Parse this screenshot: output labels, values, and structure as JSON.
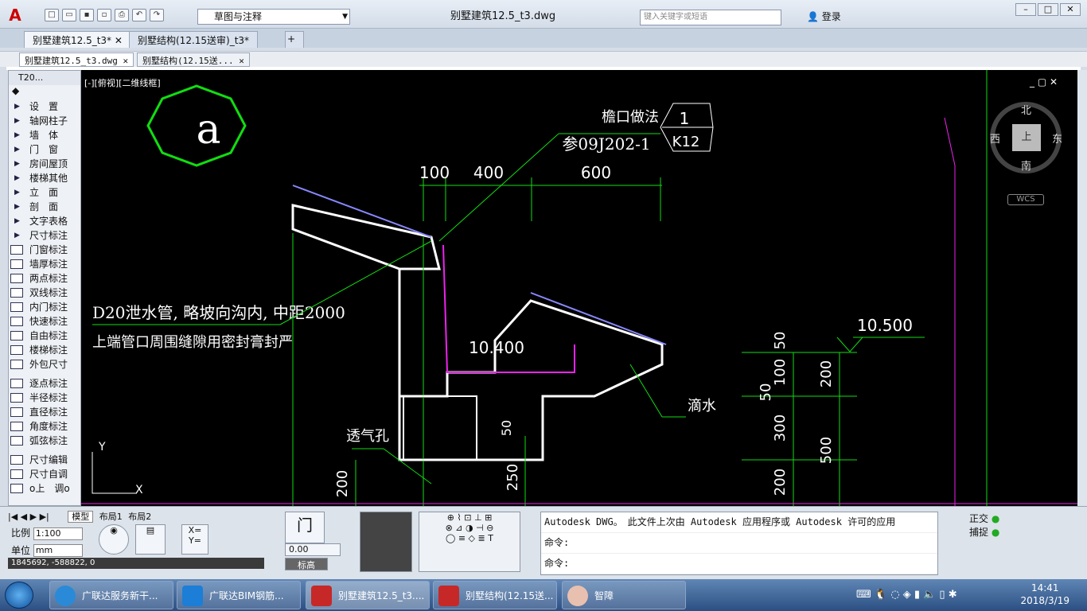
{
  "app": {
    "logo": "A",
    "workspace": "草图与注释",
    "title": "别墅建筑12.5_t3.dwg",
    "search_placeholder": "键入关键字或短语",
    "login": "登录"
  },
  "file_tabs": [
    "别墅建筑12.5_t3*",
    "别墅结构(12.15送审)_t3*"
  ],
  "doc_tabs": [
    "别墅建筑12.5_t3.dwg",
    "别墅结构(12.15送..."
  ],
  "left_panel": {
    "title": "T20...",
    "items": [
      "设　置",
      "轴网柱子",
      "墙　体",
      "门　窗",
      "房间屋顶",
      "楼梯其他",
      "立　面",
      "剖　面",
      "文字表格",
      "尺寸标注"
    ],
    "dim_items": [
      "门窗标注",
      "墙厚标注",
      "两点标注",
      "双线标注",
      "内门标注",
      "快速标注",
      "自由标注",
      "楼梯标注",
      "外包尺寸"
    ],
    "dim_items2": [
      "逐点标注",
      "半径标注",
      "直径标注",
      "角度标注",
      "弧弦标注"
    ],
    "dim_items3": [
      "尺寸编辑",
      "尺寸自调",
      "o上　调o"
    ]
  },
  "canvas": {
    "view_label": "[-][俯视][二维线框]",
    "symbol_letter": "a",
    "detail_title": "檐口做法",
    "detail_ref": "参09J202-1",
    "detail_num": "1",
    "detail_sheet": "K12",
    "dims_top": [
      "100",
      "400",
      "600"
    ],
    "note1": "D20泄水管, 略坡向沟内, 中距2000",
    "note2": "上端管口周围缝隙用密封膏封严",
    "elev1": "10.400",
    "elev2": "10.500",
    "drip": "滴水",
    "vent": "透气孔",
    "dims_right": [
      "50",
      "100",
      "50",
      "300",
      "200",
      "200",
      "500"
    ],
    "dims_left": [
      "200",
      "50",
      "250"
    ],
    "ucs_y": "Y",
    "ucs_x": "X"
  },
  "viewcube": {
    "north": "北",
    "south": "南",
    "west": "西",
    "east": "东",
    "top": "上",
    "wcs": "WCS"
  },
  "bottom": {
    "layout_tabs": [
      "模型",
      "布局1",
      "布局2"
    ],
    "scale_label": "比例",
    "scale_value": "1:100",
    "unit_label": "单位",
    "unit_value": "mm",
    "coords": "1845692, -588822, 0",
    "elev_value": "0.00",
    "elev_label": "标高",
    "ortho": "正交",
    "snap": "捕捉",
    "cmd_lines": [
      "Autodesk DWG。　此文件上次由 Autodesk 应用程序或 Autodesk 许可的应用",
      "命令:",
      "命令:"
    ]
  },
  "taskbar": {
    "items": [
      "广联达服务新干...",
      "广联达BIM钢筋...",
      "别墅建筑12.5_t3....",
      "别墅结构(12.15送...",
      "智障"
    ],
    "time": "14:41",
    "date": "2018/3/19"
  }
}
